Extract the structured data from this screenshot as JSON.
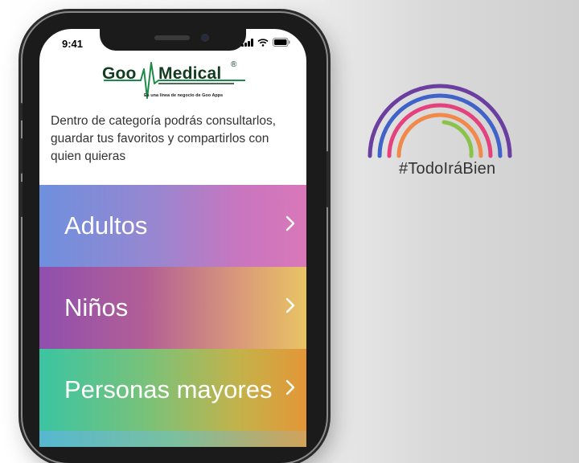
{
  "status_bar": {
    "time": "9:41"
  },
  "app": {
    "logo_left": "Goo",
    "logo_right": "Medical",
    "logo_registered": "®",
    "tagline": "Es una línea de negocio de Goo Apps",
    "intro": "Dentro de categoría podrás consultarlos, guardar tus favoritos y compartirlos con quien quieras"
  },
  "categories": [
    {
      "label": "Adultos",
      "chevron": "›"
    },
    {
      "label": "Niños",
      "chevron": "›"
    },
    {
      "label": "Personas mayores",
      "chevron": "›"
    }
  ],
  "badge": {
    "hashtag": "#TodoIráBien",
    "rainbow_colors": [
      "#6b3fa0",
      "#3f63c9",
      "#e4427d",
      "#f0894a",
      "#8ac24a"
    ]
  },
  "colors": {
    "logo_green": "#123b20",
    "ecg_green": "#1b8a4a"
  }
}
